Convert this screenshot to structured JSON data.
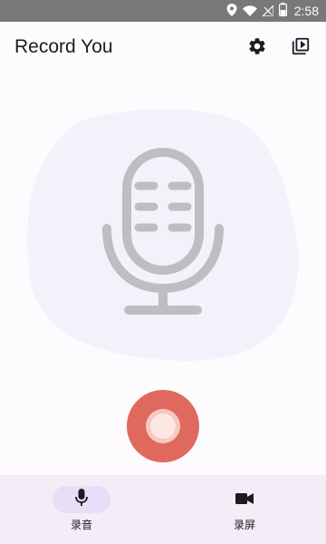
{
  "status_bar": {
    "time": "2:58",
    "icons": [
      "location-icon",
      "wifi-icon",
      "signal-icon",
      "battery-icon"
    ]
  },
  "app_bar": {
    "title": "Record You",
    "actions": [
      "settings-icon",
      "video-library-icon"
    ]
  },
  "main": {
    "illustration": "microphone-icon",
    "record_button": "record-icon"
  },
  "bottom_nav": {
    "items": [
      {
        "label": "录音",
        "icon": "mic-icon",
        "active": true
      },
      {
        "label": "录屏",
        "icon": "videocam-icon",
        "active": false
      }
    ]
  },
  "colors": {
    "status_bar": "#787878",
    "background": "#fefbff",
    "blob": "#f5f1fb",
    "mic_gray": "#bebdc1",
    "record_red": "#e0695d",
    "nav_background": "#f3edf7",
    "nav_active_pill": "#e8def8"
  }
}
